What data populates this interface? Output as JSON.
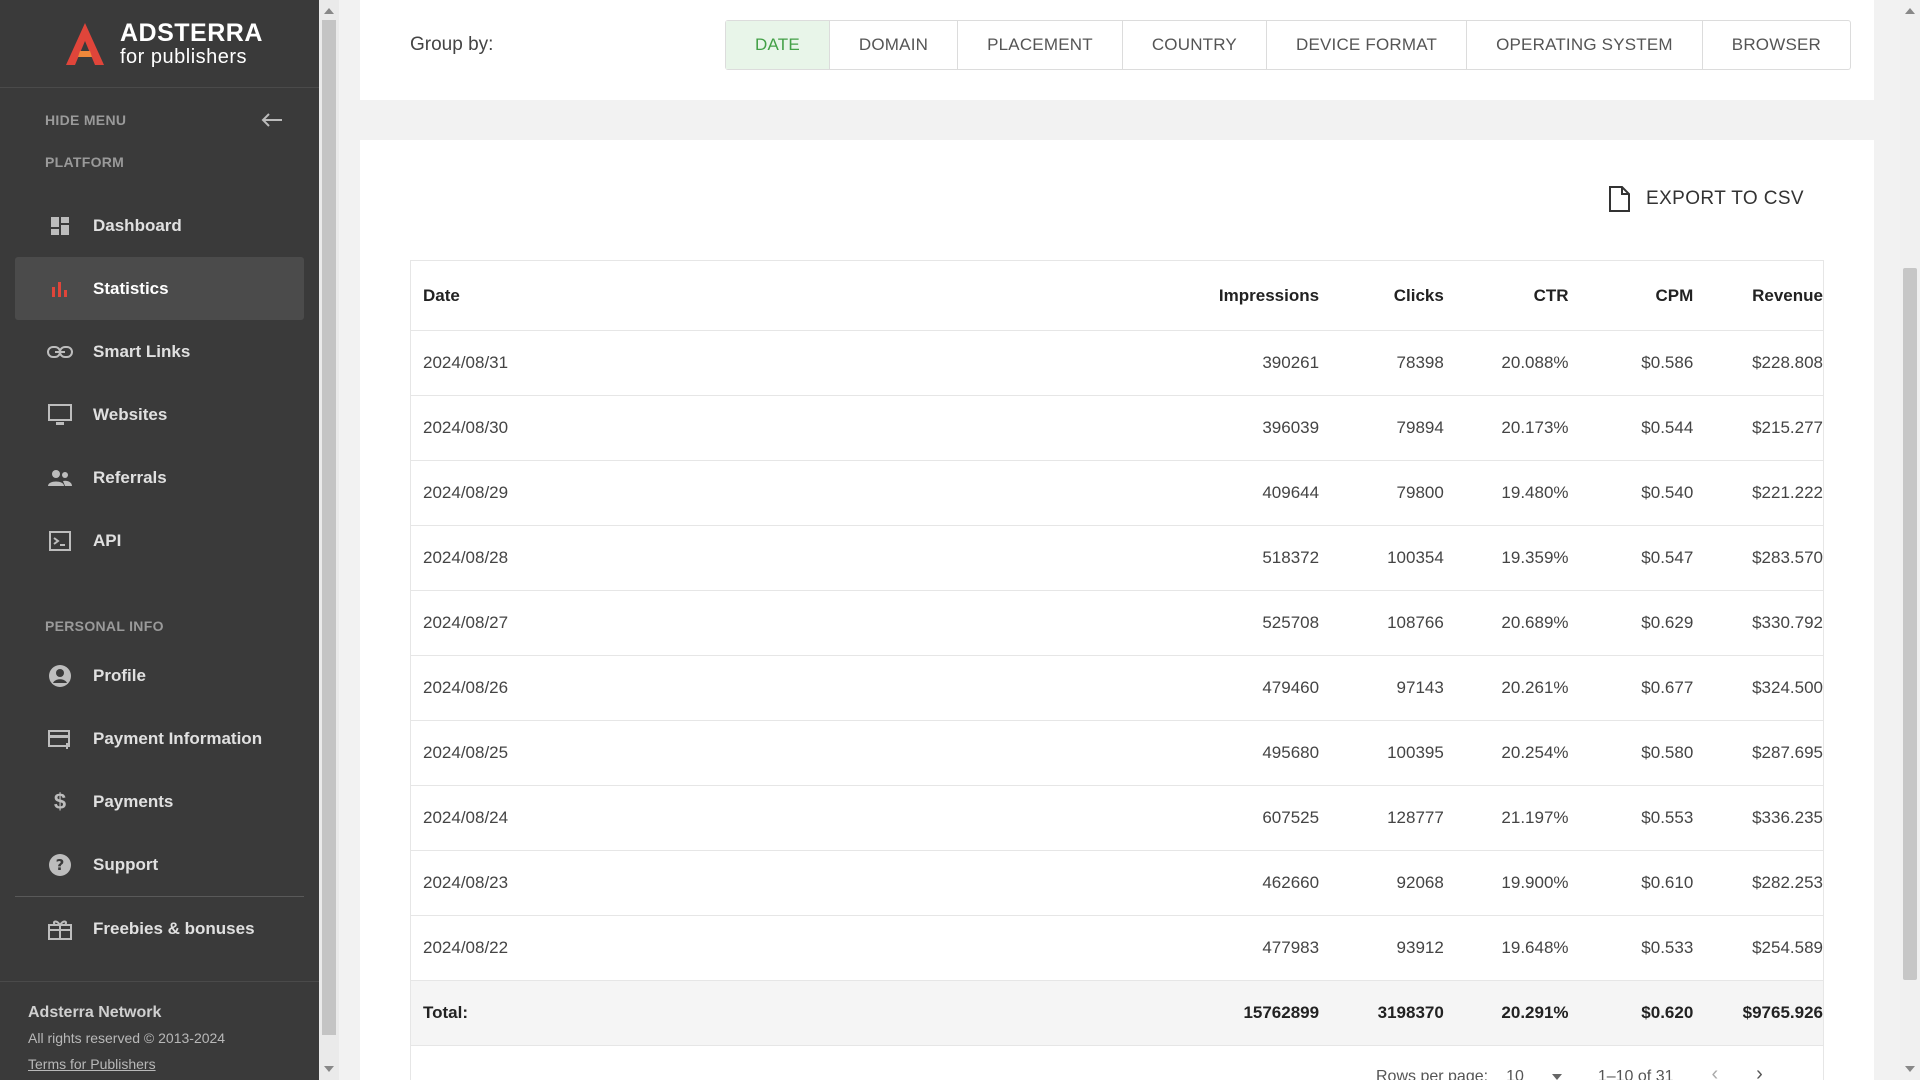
{
  "brand": {
    "name": "ADSTERRA",
    "sub": "for publishers"
  },
  "sidebar": {
    "hide_menu": "HIDE MENU",
    "platform_label": "PLATFORM",
    "platform_items": [
      {
        "label": "Dashboard",
        "icon": "dashboard-icon"
      },
      {
        "label": "Statistics",
        "icon": "bar-chart-icon",
        "active": true
      },
      {
        "label": "Smart Links",
        "icon": "link-icon"
      },
      {
        "label": "Websites",
        "icon": "monitor-icon"
      },
      {
        "label": "Referrals",
        "icon": "people-icon"
      },
      {
        "label": "API",
        "icon": "terminal-icon"
      }
    ],
    "personal_label": "PERSONAL INFO",
    "personal_items": [
      {
        "label": "Profile",
        "icon": "user-circle-icon"
      },
      {
        "label": "Payment Information",
        "icon": "credit-card-icon"
      },
      {
        "label": "Payments",
        "icon": "dollar-icon"
      },
      {
        "label": "Support",
        "icon": "help-icon"
      }
    ],
    "extra_item": {
      "label": "Freebies & bonuses",
      "icon": "gift-icon"
    },
    "footer": {
      "title": "Adsterra Network",
      "copyright": "All rights reserved © 2013-2024",
      "terms": "Terms for Publishers"
    }
  },
  "group_by": {
    "label": "Group by:",
    "tabs": [
      "DATE",
      "DOMAIN",
      "PLACEMENT",
      "COUNTRY",
      "DEVICE FORMAT",
      "OPERATING SYSTEM",
      "BROWSER"
    ],
    "active": "DATE"
  },
  "export_label": "EXPORT TO CSV",
  "table": {
    "headers": [
      "Date",
      "Impressions",
      "Clicks",
      "CTR",
      "CPM",
      "Revenue"
    ],
    "rows": [
      [
        "2024/08/31",
        "390261",
        "78398",
        "20.088%",
        "$0.586",
        "$228.808"
      ],
      [
        "2024/08/30",
        "396039",
        "79894",
        "20.173%",
        "$0.544",
        "$215.277"
      ],
      [
        "2024/08/29",
        "409644",
        "79800",
        "19.480%",
        "$0.540",
        "$221.222"
      ],
      [
        "2024/08/28",
        "518372",
        "100354",
        "19.359%",
        "$0.547",
        "$283.570"
      ],
      [
        "2024/08/27",
        "525708",
        "108766",
        "20.689%",
        "$0.629",
        "$330.792"
      ],
      [
        "2024/08/26",
        "479460",
        "97143",
        "20.261%",
        "$0.677",
        "$324.500"
      ],
      [
        "2024/08/25",
        "495680",
        "100395",
        "20.254%",
        "$0.580",
        "$287.695"
      ],
      [
        "2024/08/24",
        "607525",
        "128777",
        "21.197%",
        "$0.553",
        "$336.235"
      ],
      [
        "2024/08/23",
        "462660",
        "92068",
        "19.900%",
        "$0.610",
        "$282.253"
      ],
      [
        "2024/08/22",
        "477983",
        "93912",
        "19.648%",
        "$0.533",
        "$254.589"
      ]
    ],
    "total": [
      "Total:",
      "15762899",
      "3198370",
      "20.291%",
      "$0.620",
      "$9765.926"
    ]
  },
  "pagination": {
    "rows_per_page_label": "Rows per page:",
    "rows_per_page": "10",
    "range": "1–10 of 31"
  },
  "colors": {
    "accent_green": "#43a047",
    "brand_red": "#e0453a",
    "sidebar_bg": "#3a3a3a"
  }
}
